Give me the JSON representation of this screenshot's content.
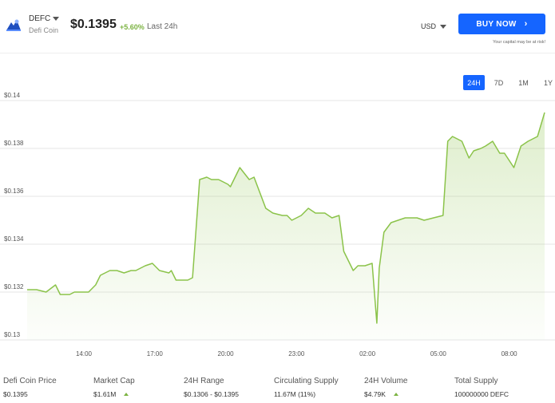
{
  "header": {
    "ticker": "DEFC",
    "coin_name": "Defi Coin",
    "price": "$0.1395",
    "change": "+5.60%",
    "change_label": "Last 24h",
    "currency": "USD",
    "buy_label": "BUY NOW",
    "risk_note": "Your capital may be at risk!"
  },
  "ranges": [
    "24H",
    "7D",
    "1M",
    "1Y"
  ],
  "active_range": "24H",
  "colors": {
    "accent": "#1565ff",
    "line": "#8bc34a",
    "positive": "#7cb342"
  },
  "icons": {
    "logo": "defi-coin-logo",
    "buy_chevron": "chevron-right-icon"
  },
  "chart_data": {
    "type": "area",
    "title": "",
    "xlabel": "",
    "ylabel": "",
    "x_ticks": [
      "14:00",
      "17:00",
      "20:00",
      "23:00",
      "02:00",
      "05:00",
      "08:00"
    ],
    "y_ticks": [
      "$0.13",
      "$0.132",
      "$0.134",
      "$0.136",
      "$0.138",
      "$0.14"
    ],
    "ylim": [
      0.13,
      0.14
    ],
    "grid": true,
    "x_tick_hours": [
      14,
      17,
      20,
      23,
      26,
      29,
      32
    ],
    "series": [
      {
        "x_hours": [
          11.6,
          12.0,
          12.4,
          12.8,
          13.0,
          13.4,
          13.6,
          14.1,
          14.2,
          14.5,
          14.7,
          15.1,
          15.4,
          15.7,
          16.0,
          16.2,
          16.6,
          16.9,
          17.2,
          17.6,
          17.7,
          17.9,
          18.4,
          18.6,
          18.9,
          19.2,
          19.4,
          19.7,
          20.1,
          20.2,
          20.6,
          21.0,
          21.2,
          21.7,
          22.0,
          22.4,
          22.6,
          22.8,
          23.2,
          23.5,
          23.8,
          24.2,
          24.5,
          24.8,
          25.0,
          25.4,
          25.6,
          25.9,
          26.2,
          26.4,
          26.5,
          26.7,
          27.0,
          27.3,
          27.6,
          28.1,
          28.4,
          28.8,
          29.2,
          29.4,
          29.6,
          30.0,
          30.3,
          30.5,
          30.8,
          31.0,
          31.3,
          31.6,
          31.8,
          32.2,
          32.5,
          32.8,
          33.2,
          33.5
        ],
        "values": [
          0.1321,
          0.1321,
          0.132,
          0.1323,
          0.1319,
          0.1319,
          0.132,
          0.132,
          0.132,
          0.1323,
          0.1327,
          0.1329,
          0.1329,
          0.1328,
          0.1329,
          0.1329,
          0.1331,
          0.1332,
          0.1329,
          0.1328,
          0.1329,
          0.1325,
          0.1325,
          0.1326,
          0.1367,
          0.1368,
          0.1367,
          0.1367,
          0.1365,
          0.1364,
          0.1372,
          0.1367,
          0.1368,
          0.1355,
          0.1353,
          0.1352,
          0.1352,
          0.135,
          0.1352,
          0.1355,
          0.1353,
          0.1353,
          0.1351,
          0.1352,
          0.1337,
          0.1329,
          0.1331,
          0.1331,
          0.1332,
          0.1307,
          0.133,
          0.1345,
          0.1349,
          0.135,
          0.1351,
          0.1351,
          0.135,
          0.1351,
          0.1352,
          0.1383,
          0.1385,
          0.1383,
          0.1376,
          0.1379,
          0.138,
          0.1381,
          0.1383,
          0.1378,
          0.1378,
          0.1372,
          0.1381,
          0.1383,
          0.1385,
          0.1395
        ]
      }
    ]
  },
  "stats": [
    {
      "label": "Defi Coin Price",
      "value": "$0.1395",
      "up": false
    },
    {
      "label": "Market Cap",
      "value": "$1.61M",
      "up": true
    },
    {
      "label": "24H Range",
      "value": "$0.1306 - $0.1395",
      "up": false
    },
    {
      "label": "Circulating Supply",
      "value": "11.67M (11%)",
      "up": false
    },
    {
      "label": "24H Volume",
      "value": "$4.79K",
      "up": true
    },
    {
      "label": "Total Supply",
      "value": "100000000 DEFC",
      "up": false
    }
  ]
}
